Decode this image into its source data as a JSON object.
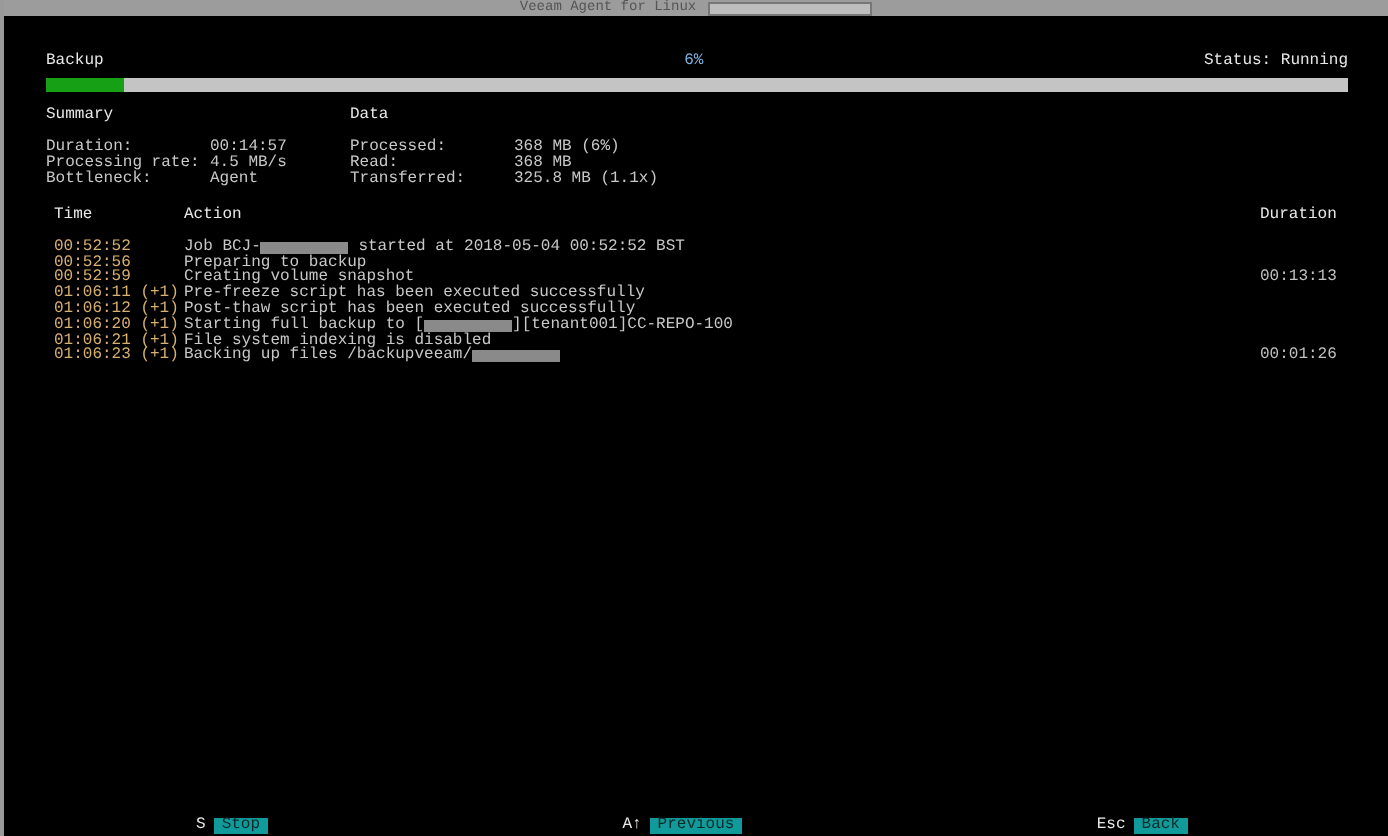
{
  "window": {
    "title": "Veeam Agent for Linux"
  },
  "job": {
    "name": "Backup",
    "percent": "6%",
    "status": "Status: Running",
    "level": 0.06
  },
  "summary": {
    "heading": "Summary",
    "rows": [
      {
        "label": "Duration:",
        "value": "00:14:57"
      },
      {
        "label": "Processing rate:",
        "value": "4.5 MB/s"
      },
      {
        "label": "Bottleneck:",
        "value": "Agent"
      }
    ]
  },
  "data": {
    "heading": "Data",
    "rows": [
      {
        "label": "Processed:",
        "value": "368 MB (6%)"
      },
      {
        "label": "Read:",
        "value": "368 MB"
      },
      {
        "label": "Transferred:",
        "value": "325.8 MB (1.1x)"
      }
    ]
  },
  "log": {
    "columns": [
      "Time",
      "Action",
      "Duration"
    ],
    "rows": [
      {
        "time": "00:52:52",
        "action": [
          {
            "kind": "text",
            "text": "Job BCJ-"
          },
          {
            "kind": "redacted"
          },
          {
            "kind": "text",
            "text": " started at 2018-05-04 00:52:52 BST"
          }
        ]
      },
      {
        "time": "00:52:56",
        "action": [
          {
            "kind": "text",
            "text": "Preparing to backup"
          }
        ]
      },
      {
        "time": "00:52:59",
        "action": [
          {
            "kind": "text",
            "text": "Creating volume snapshot"
          }
        ],
        "duration": "00:13:13"
      },
      {
        "time": "01:06:11 (+1)",
        "action": [
          {
            "kind": "text",
            "text": "Pre-freeze script has been executed successfully"
          }
        ]
      },
      {
        "time": "01:06:12 (+1)",
        "action": [
          {
            "kind": "text",
            "text": "Post-thaw script has been executed successfully"
          }
        ]
      },
      {
        "time": "01:06:20 (+1)",
        "action": [
          {
            "kind": "text",
            "text": "Starting full backup to ["
          },
          {
            "kind": "redacted"
          },
          {
            "kind": "text",
            "text": "][tenant001]CC-REPO-100"
          }
        ]
      },
      {
        "time": "01:06:21 (+1)",
        "action": [
          {
            "kind": "text",
            "text": "File system indexing is disabled"
          }
        ]
      },
      {
        "time": "01:06:23 (+1)",
        "action": [
          {
            "kind": "text",
            "text": "Backing up files /backupveeam/"
          },
          {
            "kind": "redacted"
          }
        ],
        "duration": "00:01:26"
      }
    ]
  },
  "footer": [
    {
      "key": "S",
      "label": "Stop"
    },
    {
      "key": "A↑",
      "label": "Previous"
    },
    {
      "key": "Esc",
      "label": "Back"
    }
  ]
}
